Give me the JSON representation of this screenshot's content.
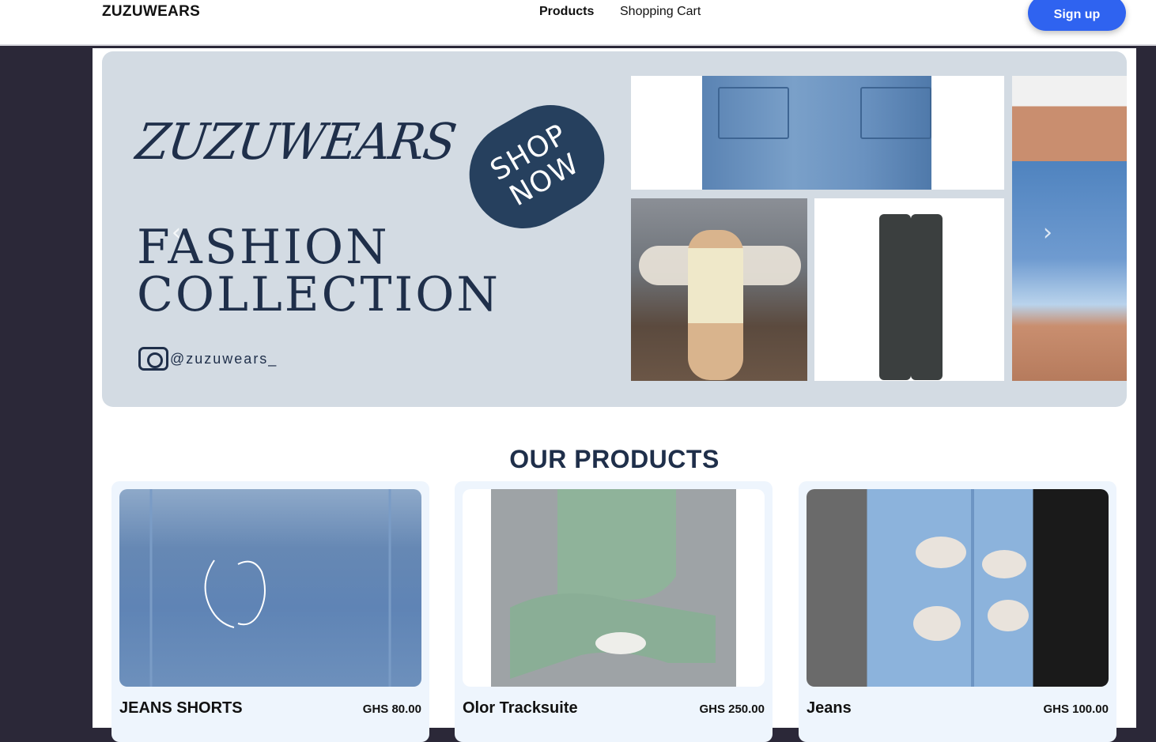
{
  "header": {
    "brand": "ZUZUWEARS",
    "nav": [
      {
        "label": "Products",
        "active": true
      },
      {
        "label": "Shopping Cart",
        "active": false
      }
    ],
    "signup_label": "Sign up",
    "accent_color": "#2f63f0"
  },
  "hero": {
    "brand_script": "ZUZUWEARS",
    "shop_now": "SHOP NOW",
    "headline_line1": "FASHION",
    "headline_line2": "COLLECTION",
    "instagram_handle": "@zuzuwears_",
    "prev_arrow": "‹",
    "next_arrow": "›"
  },
  "products_section": {
    "title": "OUR PRODUCTS",
    "items": [
      {
        "name": "JEANS SHORTS",
        "price": "GHS 80.00"
      },
      {
        "name": "Olor Tracksuite",
        "price": "GHS 250.00"
      },
      {
        "name": "Jeans",
        "price": "GHS 100.00"
      }
    ]
  }
}
